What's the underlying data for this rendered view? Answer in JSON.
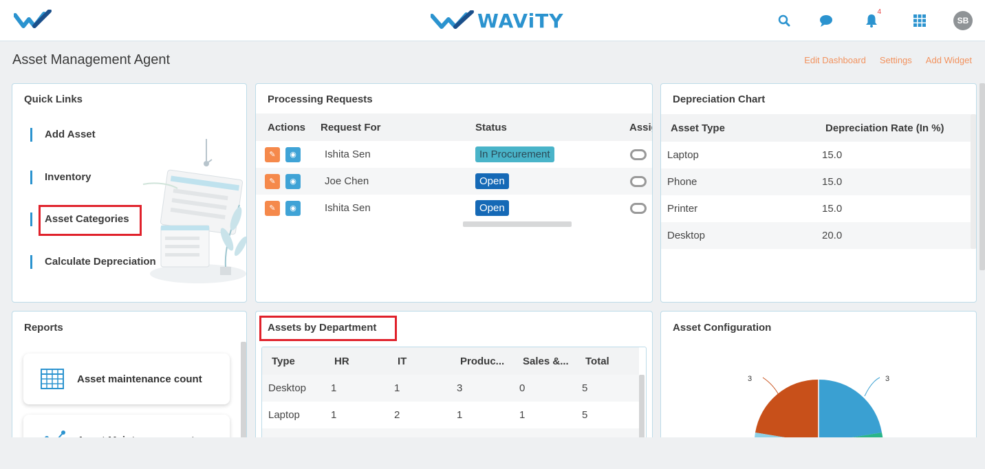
{
  "app": {
    "brand_name": "WAViTY",
    "notification_count": "4",
    "user_initials": "SB",
    "accent_color": "#2b93cf",
    "link_color": "#f2925e"
  },
  "page": {
    "title": "Asset Management Agent",
    "links": {
      "edit_dashboard": "Edit Dashboard",
      "settings": "Settings",
      "add_widget": "Add Widget"
    }
  },
  "quick_links": {
    "title": "Quick Links",
    "items": [
      "Add Asset",
      "Inventory",
      "Asset Categories",
      "Calculate Depreciation"
    ]
  },
  "processing": {
    "title": "Processing Requests",
    "headers": [
      "Actions",
      "Request For",
      "Status",
      "Assig"
    ],
    "rows": [
      {
        "request_for": "Ishita Sen",
        "status": "In Procurement",
        "status_type": "procurement"
      },
      {
        "request_for": "Joe Chen",
        "status": "Open",
        "status_type": "open"
      },
      {
        "request_for": "Ishita Sen",
        "status": "Open",
        "status_type": "open"
      }
    ]
  },
  "depreciation": {
    "title": "Depreciation Chart",
    "headers": [
      "Asset Type",
      "Depreciation Rate (In %)"
    ],
    "rows": [
      [
        "Laptop",
        "15.0"
      ],
      [
        "Phone",
        "15.0"
      ],
      [
        "Printer",
        "15.0"
      ],
      [
        "Desktop",
        "20.0"
      ]
    ]
  },
  "reports": {
    "title": "Reports",
    "items": [
      {
        "label": "Asset maintenance count",
        "icon": "table-icon"
      },
      {
        "label": "Asset Maintenance cost rep...",
        "icon": "line-chart-icon"
      }
    ]
  },
  "assets_by_department": {
    "title": "Assets by Department",
    "headers": [
      "Type",
      "HR",
      "IT",
      "Produc...",
      "Sales &...",
      "Total"
    ],
    "rows": [
      [
        "Desktop",
        "1",
        "1",
        "3",
        "0",
        "5"
      ],
      [
        "Laptop",
        "1",
        "2",
        "1",
        "1",
        "5"
      ]
    ]
  },
  "asset_configuration": {
    "title": "Asset Configuration",
    "chart_data": {
      "type": "pie",
      "labels_shown": [
        "3",
        "3"
      ],
      "slices": [
        {
          "value": 3,
          "color": "#3aa0d2"
        },
        {
          "value": 3,
          "color": "#c8501a"
        }
      ],
      "colors_visible": [
        "#3aa0d2",
        "#c8501a",
        "#2ab589",
        "#8fd1e6"
      ]
    }
  }
}
